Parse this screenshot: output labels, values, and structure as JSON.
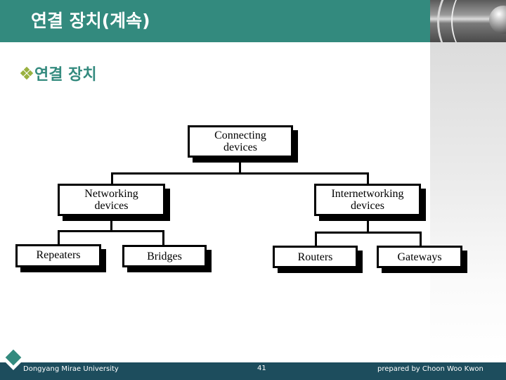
{
  "header": {
    "title": "연결 장치(계속)",
    "accent_color": "#338a7e"
  },
  "subtitle": {
    "bullet_icon": "diamond-cluster-bullet",
    "text": "연결 장치"
  },
  "diagram": {
    "root": {
      "label_line1": "Connecting",
      "label_line2": "devices"
    },
    "children": [
      {
        "label_line1": "Networking",
        "label_line2": "devices",
        "children": [
          {
            "label": "Repeaters"
          },
          {
            "label": "Bridges"
          }
        ]
      },
      {
        "label_line1": "Internetworking",
        "label_line2": "devices",
        "children": [
          {
            "label": "Routers"
          },
          {
            "label": "Gateways"
          }
        ]
      }
    ]
  },
  "footer": {
    "university": "Dongyang Mirae University",
    "page_number": "41",
    "author": "prepared by Choon Woo Kwon",
    "bar_color": "#1d4d5d"
  }
}
